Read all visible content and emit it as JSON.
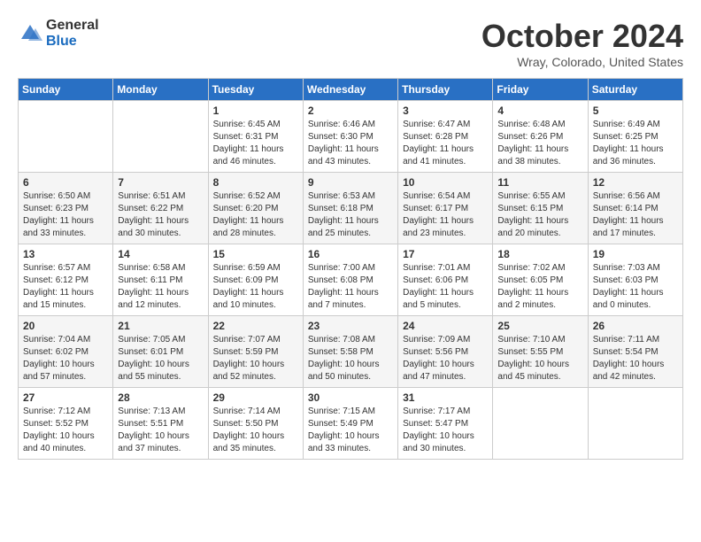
{
  "logo": {
    "general": "General",
    "blue": "Blue"
  },
  "header": {
    "month": "October 2024",
    "location": "Wray, Colorado, United States"
  },
  "weekdays": [
    "Sunday",
    "Monday",
    "Tuesday",
    "Wednesday",
    "Thursday",
    "Friday",
    "Saturday"
  ],
  "weeks": [
    [
      {
        "day": "",
        "info": ""
      },
      {
        "day": "",
        "info": ""
      },
      {
        "day": "1",
        "info": "Sunrise: 6:45 AM\nSunset: 6:31 PM\nDaylight: 11 hours and 46 minutes."
      },
      {
        "day": "2",
        "info": "Sunrise: 6:46 AM\nSunset: 6:30 PM\nDaylight: 11 hours and 43 minutes."
      },
      {
        "day": "3",
        "info": "Sunrise: 6:47 AM\nSunset: 6:28 PM\nDaylight: 11 hours and 41 minutes."
      },
      {
        "day": "4",
        "info": "Sunrise: 6:48 AM\nSunset: 6:26 PM\nDaylight: 11 hours and 38 minutes."
      },
      {
        "day": "5",
        "info": "Sunrise: 6:49 AM\nSunset: 6:25 PM\nDaylight: 11 hours and 36 minutes."
      }
    ],
    [
      {
        "day": "6",
        "info": "Sunrise: 6:50 AM\nSunset: 6:23 PM\nDaylight: 11 hours and 33 minutes."
      },
      {
        "day": "7",
        "info": "Sunrise: 6:51 AM\nSunset: 6:22 PM\nDaylight: 11 hours and 30 minutes."
      },
      {
        "day": "8",
        "info": "Sunrise: 6:52 AM\nSunset: 6:20 PM\nDaylight: 11 hours and 28 minutes."
      },
      {
        "day": "9",
        "info": "Sunrise: 6:53 AM\nSunset: 6:18 PM\nDaylight: 11 hours and 25 minutes."
      },
      {
        "day": "10",
        "info": "Sunrise: 6:54 AM\nSunset: 6:17 PM\nDaylight: 11 hours and 23 minutes."
      },
      {
        "day": "11",
        "info": "Sunrise: 6:55 AM\nSunset: 6:15 PM\nDaylight: 11 hours and 20 minutes."
      },
      {
        "day": "12",
        "info": "Sunrise: 6:56 AM\nSunset: 6:14 PM\nDaylight: 11 hours and 17 minutes."
      }
    ],
    [
      {
        "day": "13",
        "info": "Sunrise: 6:57 AM\nSunset: 6:12 PM\nDaylight: 11 hours and 15 minutes."
      },
      {
        "day": "14",
        "info": "Sunrise: 6:58 AM\nSunset: 6:11 PM\nDaylight: 11 hours and 12 minutes."
      },
      {
        "day": "15",
        "info": "Sunrise: 6:59 AM\nSunset: 6:09 PM\nDaylight: 11 hours and 10 minutes."
      },
      {
        "day": "16",
        "info": "Sunrise: 7:00 AM\nSunset: 6:08 PM\nDaylight: 11 hours and 7 minutes."
      },
      {
        "day": "17",
        "info": "Sunrise: 7:01 AM\nSunset: 6:06 PM\nDaylight: 11 hours and 5 minutes."
      },
      {
        "day": "18",
        "info": "Sunrise: 7:02 AM\nSunset: 6:05 PM\nDaylight: 11 hours and 2 minutes."
      },
      {
        "day": "19",
        "info": "Sunrise: 7:03 AM\nSunset: 6:03 PM\nDaylight: 11 hours and 0 minutes."
      }
    ],
    [
      {
        "day": "20",
        "info": "Sunrise: 7:04 AM\nSunset: 6:02 PM\nDaylight: 10 hours and 57 minutes."
      },
      {
        "day": "21",
        "info": "Sunrise: 7:05 AM\nSunset: 6:01 PM\nDaylight: 10 hours and 55 minutes."
      },
      {
        "day": "22",
        "info": "Sunrise: 7:07 AM\nSunset: 5:59 PM\nDaylight: 10 hours and 52 minutes."
      },
      {
        "day": "23",
        "info": "Sunrise: 7:08 AM\nSunset: 5:58 PM\nDaylight: 10 hours and 50 minutes."
      },
      {
        "day": "24",
        "info": "Sunrise: 7:09 AM\nSunset: 5:56 PM\nDaylight: 10 hours and 47 minutes."
      },
      {
        "day": "25",
        "info": "Sunrise: 7:10 AM\nSunset: 5:55 PM\nDaylight: 10 hours and 45 minutes."
      },
      {
        "day": "26",
        "info": "Sunrise: 7:11 AM\nSunset: 5:54 PM\nDaylight: 10 hours and 42 minutes."
      }
    ],
    [
      {
        "day": "27",
        "info": "Sunrise: 7:12 AM\nSunset: 5:52 PM\nDaylight: 10 hours and 40 minutes."
      },
      {
        "day": "28",
        "info": "Sunrise: 7:13 AM\nSunset: 5:51 PM\nDaylight: 10 hours and 37 minutes."
      },
      {
        "day": "29",
        "info": "Sunrise: 7:14 AM\nSunset: 5:50 PM\nDaylight: 10 hours and 35 minutes."
      },
      {
        "day": "30",
        "info": "Sunrise: 7:15 AM\nSunset: 5:49 PM\nDaylight: 10 hours and 33 minutes."
      },
      {
        "day": "31",
        "info": "Sunrise: 7:17 AM\nSunset: 5:47 PM\nDaylight: 10 hours and 30 minutes."
      },
      {
        "day": "",
        "info": ""
      },
      {
        "day": "",
        "info": ""
      }
    ]
  ]
}
